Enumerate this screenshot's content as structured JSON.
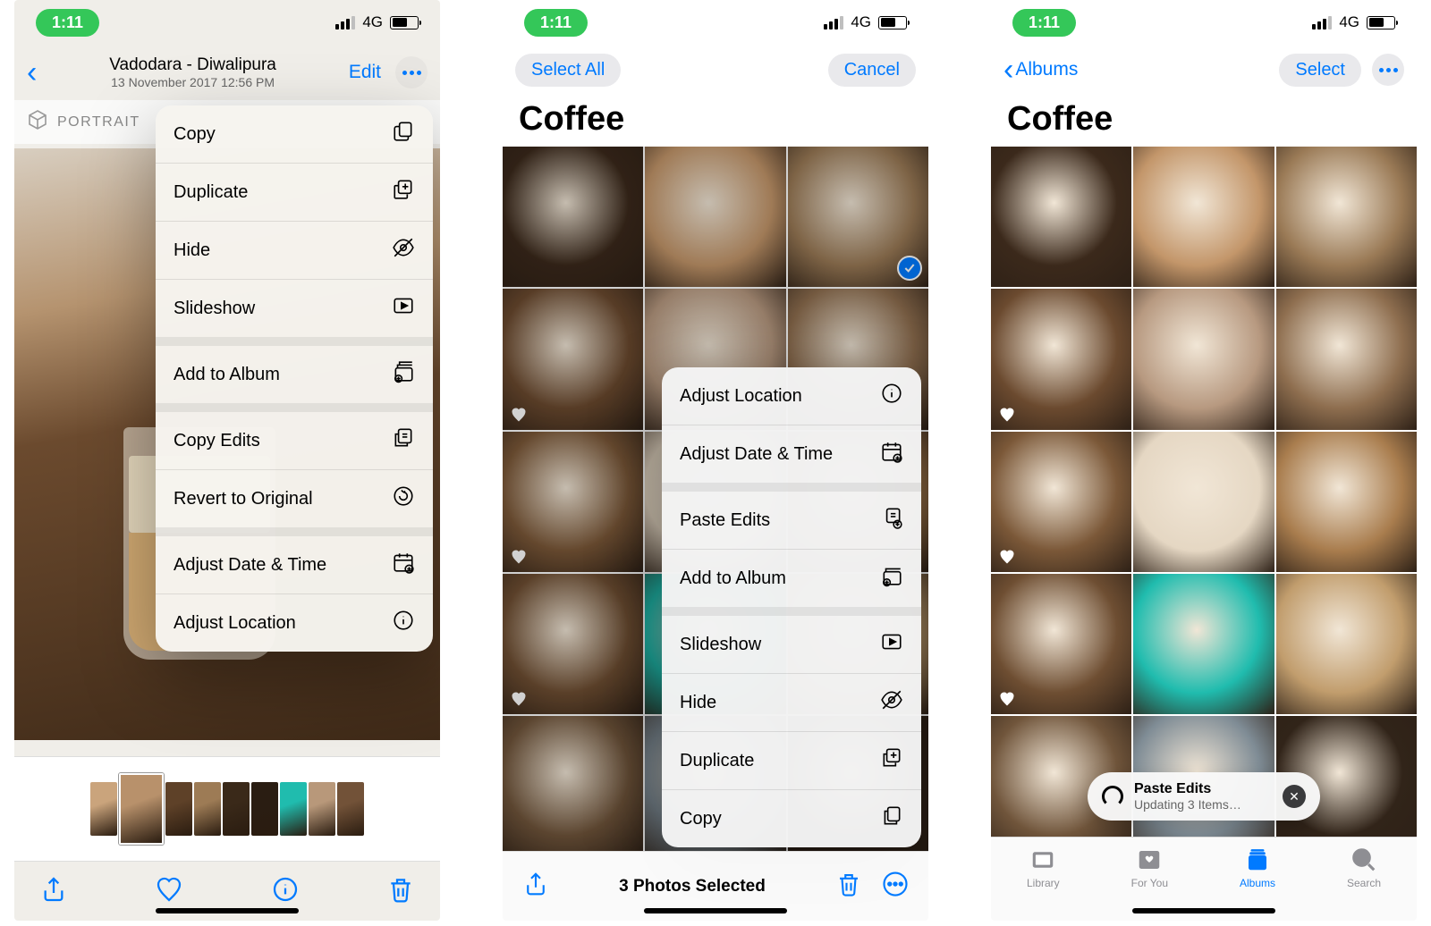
{
  "status": {
    "time": "1:11",
    "network": "4G"
  },
  "screen1": {
    "nav": {
      "title": "Vadodara - Diwalipura",
      "subtitle": "13 November 2017  12:56 PM",
      "edit": "Edit"
    },
    "portrait_label": "PORTRAIT",
    "menu": {
      "copy": "Copy",
      "duplicate": "Duplicate",
      "hide": "Hide",
      "slideshow": "Slideshow",
      "add_album": "Add to Album",
      "copy_edits": "Copy Edits",
      "revert": "Revert to Original",
      "adjust_dt": "Adjust Date & Time",
      "adjust_loc": "Adjust Location"
    }
  },
  "screen2": {
    "nav": {
      "select_all": "Select All",
      "cancel": "Cancel"
    },
    "title": "Coffee",
    "toolbar_text": "3 Photos Selected",
    "menu": {
      "adjust_loc": "Adjust Location",
      "adjust_dt": "Adjust Date & Time",
      "paste_edits": "Paste Edits",
      "add_album": "Add to Album",
      "slideshow": "Slideshow",
      "hide": "Hide",
      "duplicate": "Duplicate",
      "copy": "Copy"
    }
  },
  "screen3": {
    "nav": {
      "back": "Albums",
      "select": "Select"
    },
    "title": "Coffee",
    "toast": {
      "title": "Paste Edits",
      "subtitle": "Updating 3 Items…"
    },
    "tabs": {
      "library": "Library",
      "foryou": "For You",
      "albums": "Albums",
      "search": "Search"
    }
  },
  "cell_colors": [
    [
      "#3b291b",
      "#c3966a",
      "#9a7a56"
    ],
    [
      "#6b4a2f",
      "#b79980",
      "#8e6e4f"
    ],
    [
      "#7b5838",
      "#e5d7c3",
      "#a97d4e"
    ],
    [
      "#6e4e32",
      "#20bcae",
      "#c19d6d"
    ],
    [
      "#70553b",
      "#7f8c95",
      "#312419"
    ]
  ],
  "thumbstrip_colors": [
    "#caa47c",
    "#b8916b",
    "#5e4128",
    "#9d7b55",
    "#3a2919",
    "#2a1d12",
    "#20bcae",
    "#b8987a",
    "#725238"
  ]
}
